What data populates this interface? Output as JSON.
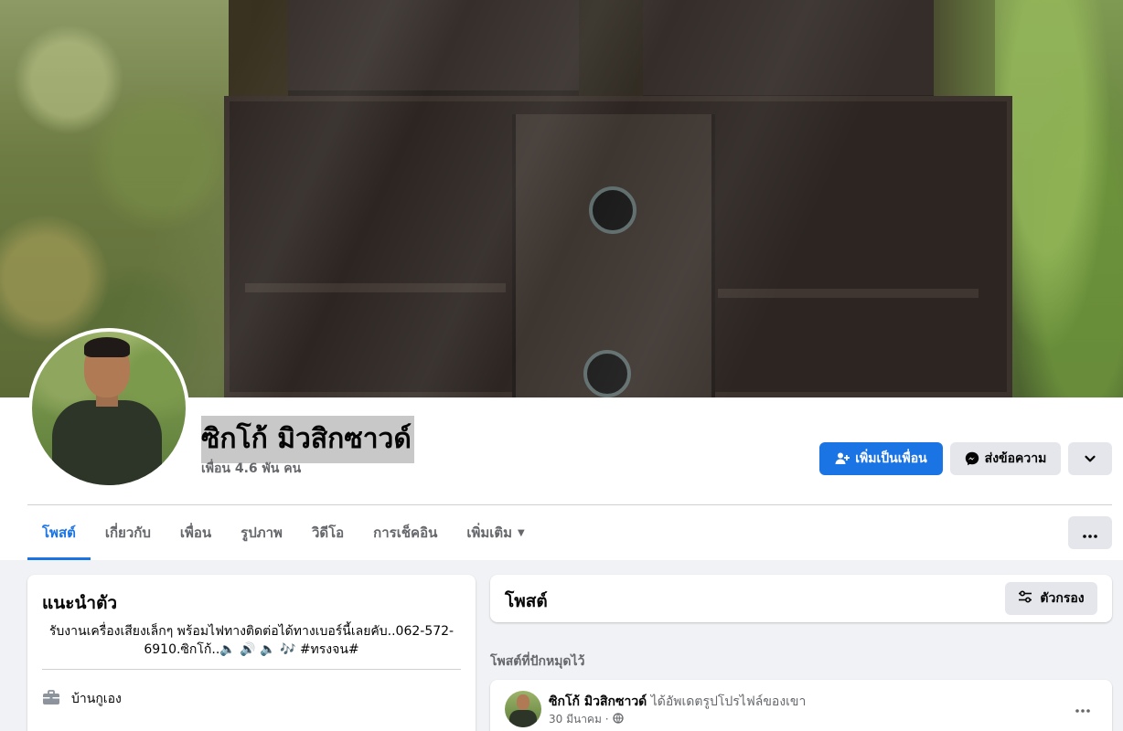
{
  "profile": {
    "name": "ซิกโก้ มิวสิกซาวด์",
    "friends": "เพื่อน 4.6 พัน คน"
  },
  "actions": {
    "add_friend": "เพิ่มเป็นเพื่อน",
    "message": "ส่งข้อความ"
  },
  "tabs": [
    {
      "label": "โพสต์",
      "active": true
    },
    {
      "label": "เกี่ยวกับ"
    },
    {
      "label": "เพื่อน"
    },
    {
      "label": "รูปภาพ"
    },
    {
      "label": "วิดีโอ"
    },
    {
      "label": "การเช็คอิน"
    },
    {
      "label": "เพิ่มเติม"
    }
  ],
  "intro": {
    "title": "แนะนำตัว",
    "bio": "รับงานเครื่องเสียงเล็กๆ พร้อมไฟทางติดต่อได้ทางเบอร์นี้เลยคับ..062-572-6910.ซิกโก้..🔈 🔊 🔈 🎶 #ทรงจน#",
    "workplace": "บ้านกูเอง"
  },
  "posts": {
    "title": "โพสต์",
    "filter": "ตัวกรอง",
    "pinned_label": "โพสต์ที่ปักหมุดไว้",
    "pinned": {
      "author": "ซิกโก้ มิวสิกซาวด์",
      "action": "ได้อัพเดตรูปโปรไฟล์ของเขา",
      "date": "30 มีนาคม ·"
    }
  },
  "colors": {
    "accent": "#1b74e4",
    "button_secondary": "#e4e6eb",
    "page_bg": "#f0f2f5",
    "muted_text": "#65676b"
  },
  "icons": {
    "add_friend": "person-plus-icon",
    "message": "messenger-icon",
    "more": "chevron-down-icon",
    "tab_more": "ellipsis-icon",
    "filter": "sliders-icon",
    "work": "briefcase-icon",
    "privacy": "globe-icon"
  }
}
